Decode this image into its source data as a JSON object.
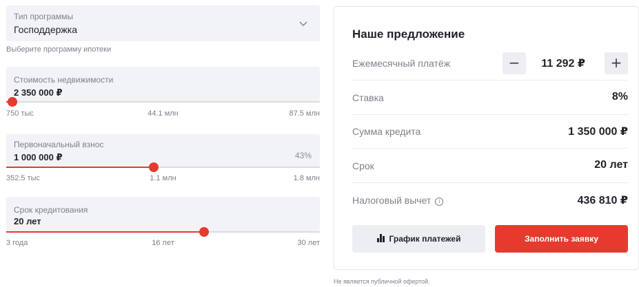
{
  "program": {
    "label": "Тип программы",
    "value": "Господдержка",
    "hint": "Выберите программу ипотеки"
  },
  "cost": {
    "label": "Стоимость недвижимости",
    "value": "2 350 000 ₽",
    "ticks": [
      "750 тыс",
      "44.1 млн",
      "87.5 млн"
    ],
    "fraction": 0.02
  },
  "down_payment": {
    "label": "Первоначальный взнос",
    "value": "1 000 000 ₽",
    "percent": "43%",
    "ticks": [
      "352.5 тыс",
      "1.1 млн",
      "1.8 млн"
    ],
    "fraction": 0.47
  },
  "term": {
    "label": "Срок кредитования",
    "value": "20 лет",
    "ticks": [
      "3 года",
      "16 лет",
      "30 лет"
    ],
    "fraction": 0.63
  },
  "offer": {
    "title": "Наше предложение",
    "monthly_label": "Ежемесячный платёж",
    "monthly_value": "11 292 ₽",
    "minus": "−",
    "plus": "+",
    "rate_label": "Ставка",
    "rate_value": "8%",
    "loan_label": "Сумма кредита",
    "loan_value": "1 350 000 ₽",
    "term_label": "Срок",
    "term_value": "20 лет",
    "tax_label": "Налоговый вычет",
    "tax_info": "i",
    "tax_value": "436 810 ₽",
    "schedule_button": "График платежей",
    "apply_button": "Заполнить заявку"
  },
  "disclaimer": "Не является публичной офертой.",
  "colors": {
    "accent": "#e63a2e",
    "field_bg": "#f2f3f7",
    "muted_text": "#7d8189"
  }
}
